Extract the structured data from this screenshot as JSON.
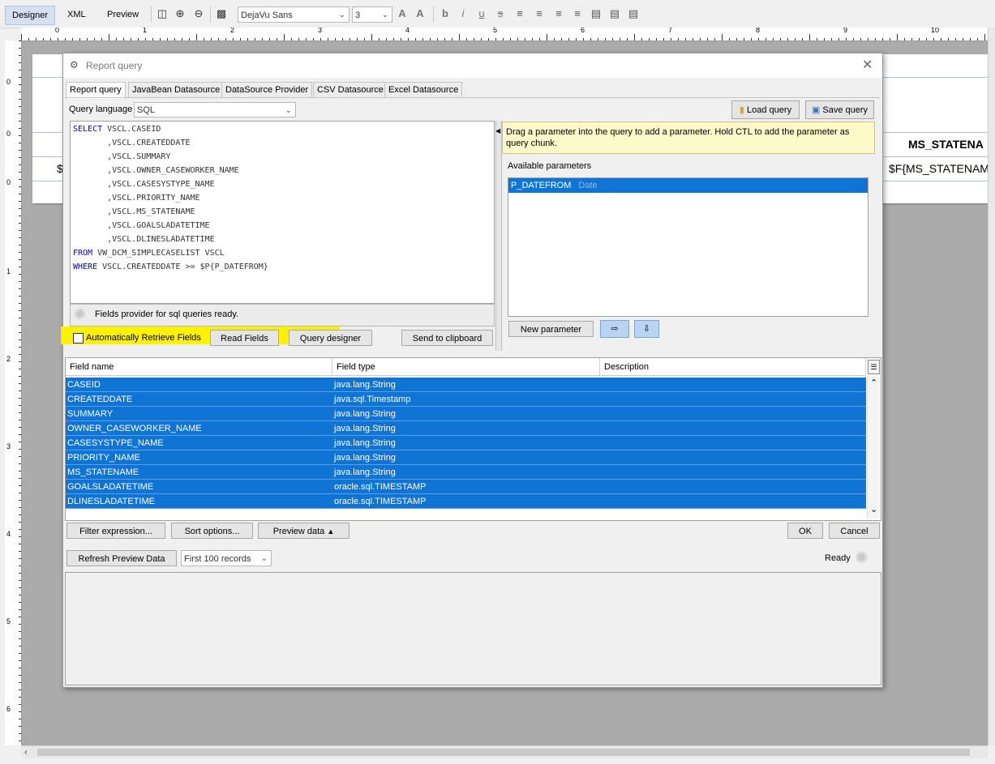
{
  "toolbar": {
    "tabs": [
      "Designer",
      "XML",
      "Preview"
    ],
    "font_family": "DejaVu Sans",
    "font_size": "3"
  },
  "ruler": {
    "h_marks": [
      "0",
      "1",
      "2",
      "3",
      "4",
      "5",
      "6",
      "7",
      "8",
      "9",
      "10"
    ],
    "v_marks": [
      "0",
      "0",
      "0",
      "1",
      "2",
      "3",
      "4",
      "5",
      "6"
    ]
  },
  "canvas": {
    "header_label": "MS_STATENA",
    "detail_field": "$F{MS_STATENAM",
    "left_field": "$"
  },
  "dialog": {
    "title": "Report query",
    "tabs": [
      "Report query",
      "JavaBean Datasource",
      "DataSource Provider",
      "CSV Datasource",
      "Excel Datasource"
    ],
    "query_language_label": "Query language",
    "query_language": "SQL",
    "load_query": "Load query",
    "save_query": "Save query",
    "sql_lines": [
      {
        "kw": "SELECT",
        "text": " VSCL.CASEID"
      },
      {
        "kw": "",
        "text": "       ,VSCL.CREATEDDATE"
      },
      {
        "kw": "",
        "text": "       ,VSCL.SUMMARY"
      },
      {
        "kw": "",
        "text": "       ,VSCL.OWNER_CASEWORKER_NAME"
      },
      {
        "kw": "",
        "text": "       ,VSCL.CASESYSTYPE_NAME"
      },
      {
        "kw": "",
        "text": "       ,VSCL.PRIORITY_NAME"
      },
      {
        "kw": "",
        "text": "       ,VSCL.MS_STATENAME"
      },
      {
        "kw": "",
        "text": "       ,VSCL.GOALSLADATETIME"
      },
      {
        "kw": "",
        "text": "       ,VSCL.DLINESLADATETIME"
      },
      {
        "kw": "FROM",
        "text": " VW_DCM_SIMPLECASELIST VSCL"
      },
      {
        "kw": "WHERE",
        "text": " VSCL.CREATEDDATE >= $P{P_DATEFROM}"
      }
    ],
    "hint": "Drag a parameter into the query to add a parameter. Hold CTL to add the parameter as query chunk.",
    "available_parameters_label": "Available parameters",
    "parameters": [
      {
        "name": "P_DATEFROM",
        "type": "Date"
      }
    ],
    "status": "Fields provider for sql queries ready.",
    "auto_retrieve_label": "Automatically Retrieve Fields",
    "read_fields": "Read Fields",
    "query_designer": "Query designer",
    "send_to_clipboard": "Send to clipboard",
    "new_parameter": "New parameter",
    "fields_columns": [
      "Field name",
      "Field type",
      "Description"
    ],
    "fields": [
      {
        "name": "CASEID",
        "type": "java.lang.String",
        "desc": ""
      },
      {
        "name": "CREATEDDATE",
        "type": "java.sql.Timestamp",
        "desc": ""
      },
      {
        "name": "SUMMARY",
        "type": "java.lang.String",
        "desc": ""
      },
      {
        "name": "OWNER_CASEWORKER_NAME",
        "type": "java.lang.String",
        "desc": ""
      },
      {
        "name": "CASESYSTYPE_NAME",
        "type": "java.lang.String",
        "desc": ""
      },
      {
        "name": "PRIORITY_NAME",
        "type": "java.lang.String",
        "desc": ""
      },
      {
        "name": "MS_STATENAME",
        "type": "java.lang.String",
        "desc": ""
      },
      {
        "name": "GOALSLADATETIME",
        "type": "oracle.sql.TIMESTAMP",
        "desc": ""
      },
      {
        "name": "DLINESLADATETIME",
        "type": "oracle.sql.TIMESTAMP",
        "desc": ""
      }
    ],
    "filter_expression": "Filter expression...",
    "sort_options": "Sort options...",
    "preview_data": "Preview data",
    "ok": "OK",
    "cancel": "Cancel",
    "refresh_preview": "Refresh Preview Data",
    "record_limit": "First 100 records",
    "ready": "Ready"
  }
}
